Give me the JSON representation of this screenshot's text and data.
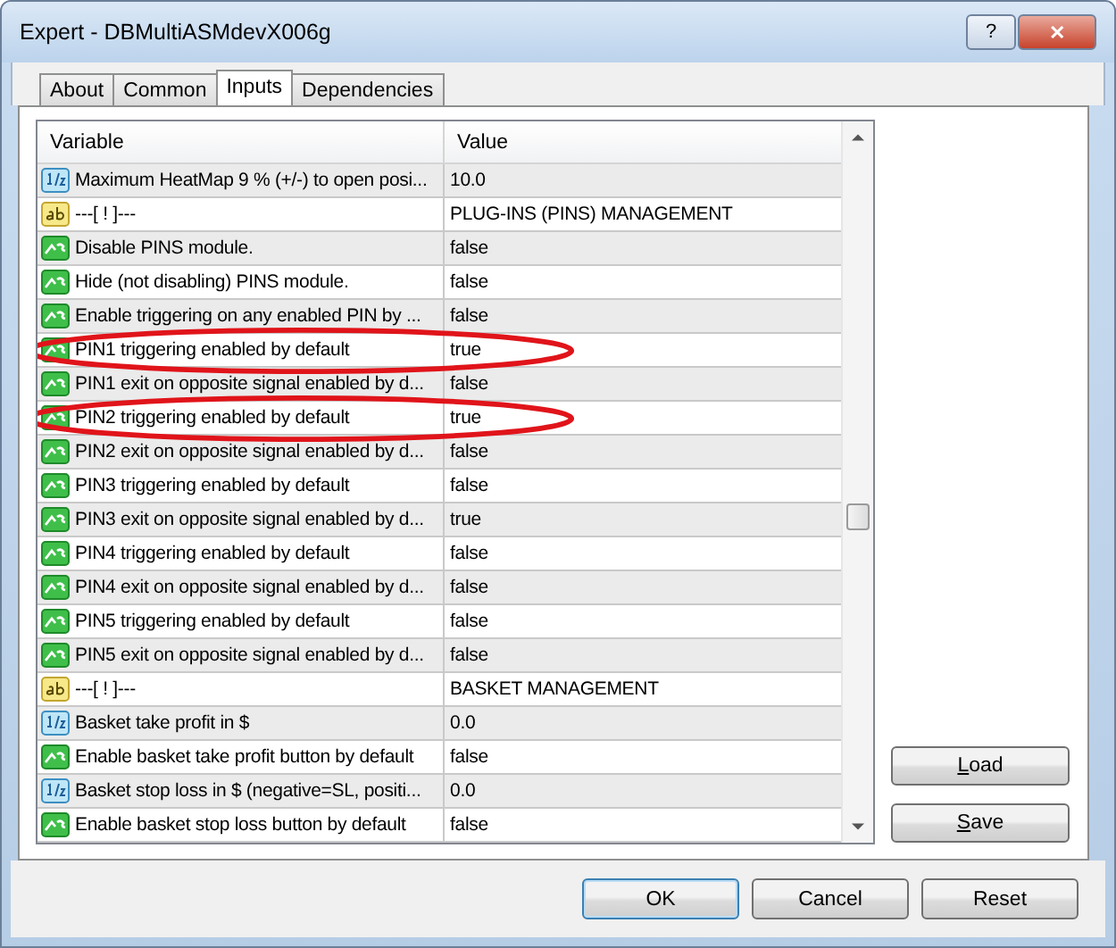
{
  "window": {
    "title": "Expert - DBMultiASMdevX006g",
    "buttons": [
      "?",
      "✕"
    ]
  },
  "tabs": [
    {
      "label": "About",
      "selected": false
    },
    {
      "label": "Common",
      "selected": false
    },
    {
      "label": "Inputs",
      "selected": true
    },
    {
      "label": "Dependencies",
      "selected": false
    }
  ],
  "table": {
    "columns": [
      "Variable",
      "Value"
    ],
    "rows": [
      {
        "kind": "double",
        "variable": "Maximum HeatMap 9 % (+/-) to open posi...",
        "value": "10.0",
        "circled": false
      },
      {
        "kind": "string",
        "variable": "---[ ! ]---",
        "value": "PLUG-INS (PINS) MANAGEMENT",
        "circled": false
      },
      {
        "kind": "bool",
        "variable": "Disable PINS module.",
        "value": "false",
        "circled": false
      },
      {
        "kind": "bool",
        "variable": "Hide (not disabling) PINS module.",
        "value": "false",
        "circled": false
      },
      {
        "kind": "bool",
        "variable": "Enable triggering on any enabled PIN by ...",
        "value": "false",
        "circled": false
      },
      {
        "kind": "bool",
        "variable": "PIN1 triggering enabled by default",
        "value": "true",
        "circled": true
      },
      {
        "kind": "bool",
        "variable": "PIN1 exit on opposite signal enabled by d...",
        "value": "false",
        "circled": false
      },
      {
        "kind": "bool",
        "variable": "PIN2 triggering enabled by default",
        "value": "true",
        "circled": true
      },
      {
        "kind": "bool",
        "variable": "PIN2 exit on opposite signal enabled by d...",
        "value": "false",
        "circled": false
      },
      {
        "kind": "bool",
        "variable": "PIN3 triggering enabled by default",
        "value": "false",
        "circled": false
      },
      {
        "kind": "bool",
        "variable": "PIN3 exit on opposite signal enabled by d...",
        "value": "true",
        "circled": false
      },
      {
        "kind": "bool",
        "variable": "PIN4 triggering enabled by default",
        "value": "false",
        "circled": false
      },
      {
        "kind": "bool",
        "variable": "PIN4 exit on opposite signal enabled by d...",
        "value": "false",
        "circled": false
      },
      {
        "kind": "bool",
        "variable": "PIN5 triggering enabled by default",
        "value": "false",
        "circled": false
      },
      {
        "kind": "bool",
        "variable": "PIN5 exit on opposite signal enabled by d...",
        "value": "false",
        "circled": false
      },
      {
        "kind": "string",
        "variable": "---[ ! ]---",
        "value": "BASKET MANAGEMENT",
        "circled": false
      },
      {
        "kind": "double",
        "variable": "Basket take profit in $",
        "value": "0.0",
        "circled": false
      },
      {
        "kind": "bool",
        "variable": "Enable basket take profit button by default",
        "value": "false",
        "circled": false
      },
      {
        "kind": "double",
        "variable": "Basket stop loss in $ (negative=SL, positi...",
        "value": "0.0",
        "circled": false
      },
      {
        "kind": "bool",
        "variable": "Enable basket stop loss button by default",
        "value": "false",
        "circled": false
      }
    ]
  },
  "side_buttons": [
    {
      "label": "Load",
      "mnemonic": true
    },
    {
      "label": "Save",
      "mnemonic": true
    }
  ],
  "footer_buttons": [
    {
      "label": "OK",
      "default": true
    },
    {
      "label": "Cancel",
      "default": false
    },
    {
      "label": "Reset",
      "default": false
    }
  ]
}
